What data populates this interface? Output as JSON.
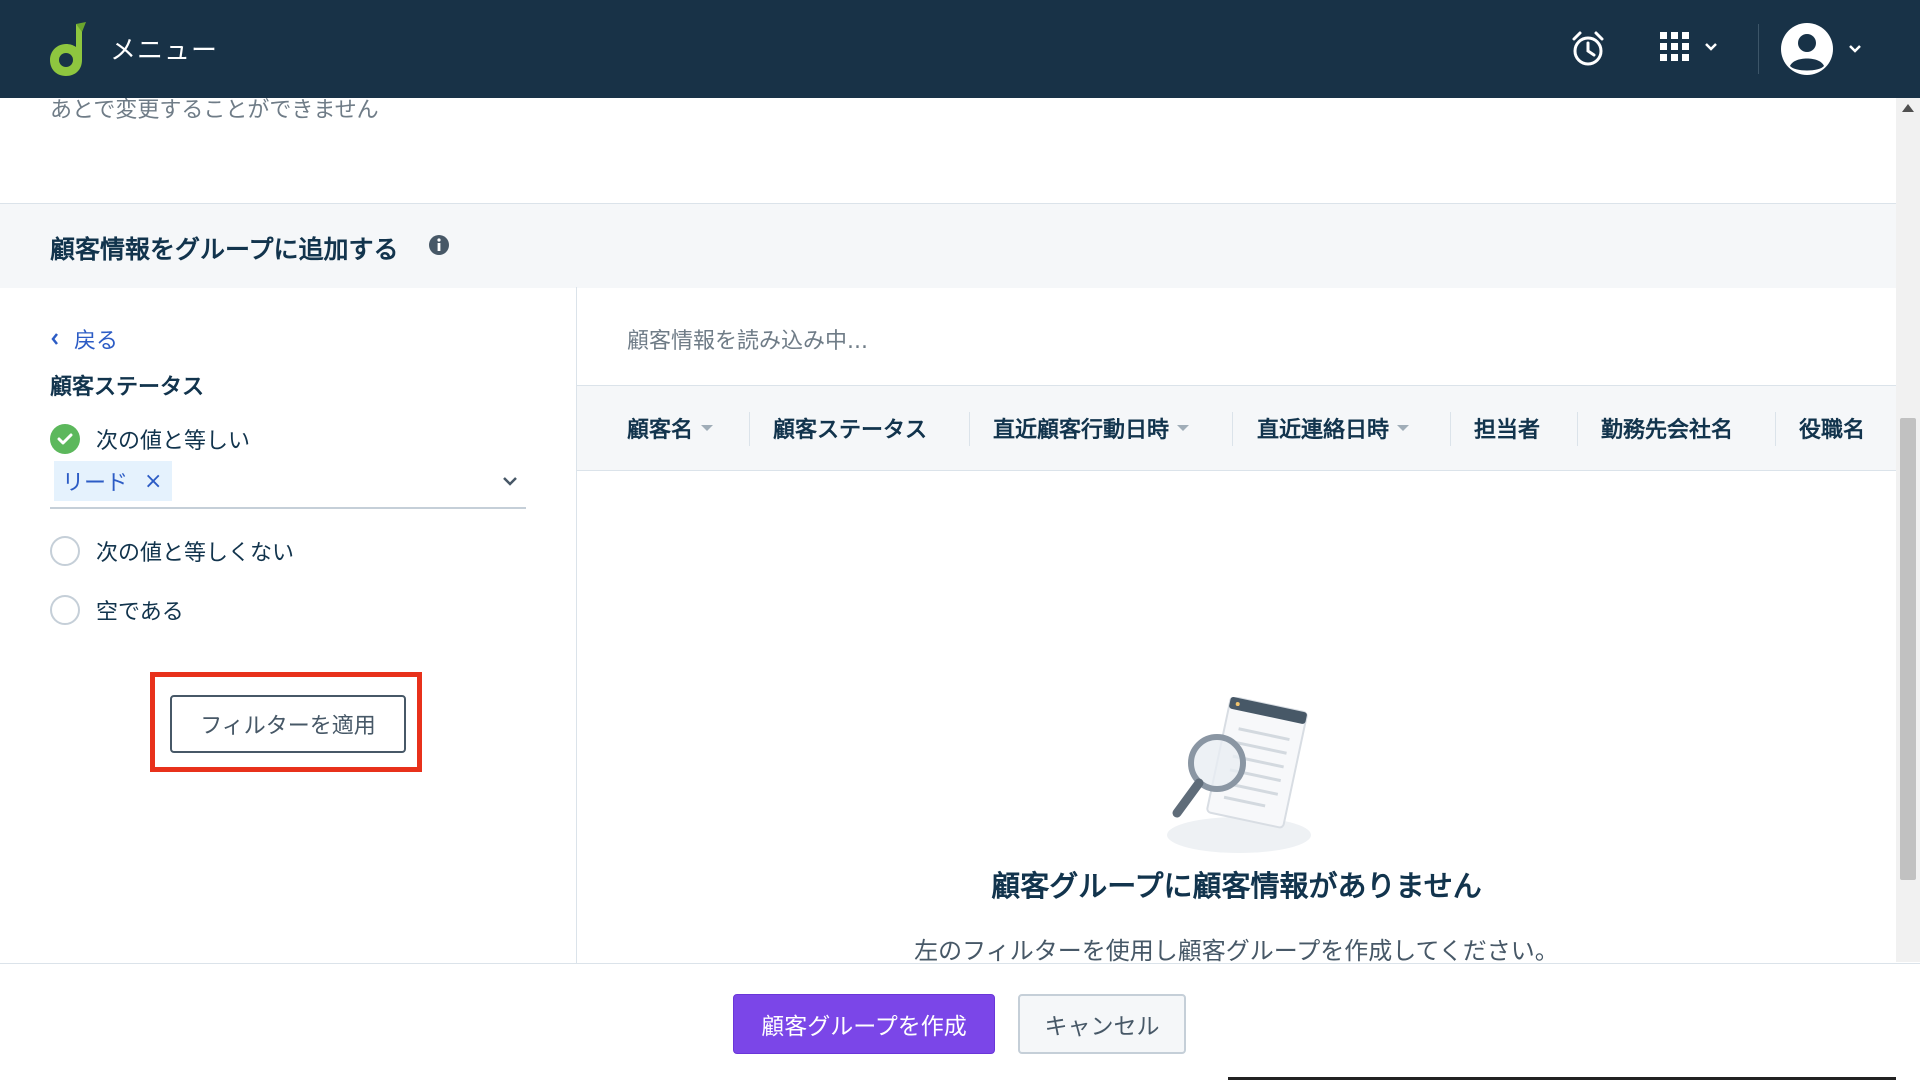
{
  "topbar": {
    "menu_label": "メニュー",
    "icons": [
      "logo-icon",
      "alarm-clock-icon",
      "apps-grid-icon",
      "chevron-down-icon",
      "user-avatar-icon"
    ]
  },
  "form": {
    "description": "あとで変更することができません"
  },
  "section": {
    "title": "顧客情報をグループに追加する"
  },
  "filter": {
    "back_label": "戻る",
    "title": "顧客ステータス",
    "options": [
      {
        "label": "次の値と等しい",
        "checked": true
      },
      {
        "label": "次の値と等しくない",
        "checked": false
      },
      {
        "label": "空である",
        "checked": false
      }
    ],
    "selected_chip": "リード",
    "chip_remove": "×",
    "apply_label": "フィルターを適用"
  },
  "results": {
    "loading_text": "顧客情報を読み込み中...",
    "columns": [
      {
        "label": "顧客名",
        "sortable": true
      },
      {
        "label": "顧客ステータス",
        "sortable": false
      },
      {
        "label": "直近顧客行動日時",
        "sortable": true
      },
      {
        "label": "直近連絡日時",
        "sortable": true
      },
      {
        "label": "担当者",
        "sortable": false
      },
      {
        "label": "勤務先会社名",
        "sortable": false
      },
      {
        "label": "役職名",
        "sortable": false
      }
    ],
    "empty_title": "顧客グループに顧客情報がありません",
    "empty_subtitle": "左のフィルターを使用し顧客グループを作成してください。"
  },
  "footer": {
    "create_label": "顧客グループを作成",
    "cancel_label": "キャンセル"
  },
  "colors": {
    "nav_bg": "#183247",
    "accent_green": "#5cb85c",
    "primary_purple": "#7b46e8",
    "link_blue": "#2c5cc5",
    "highlight_red": "#e8311b"
  }
}
